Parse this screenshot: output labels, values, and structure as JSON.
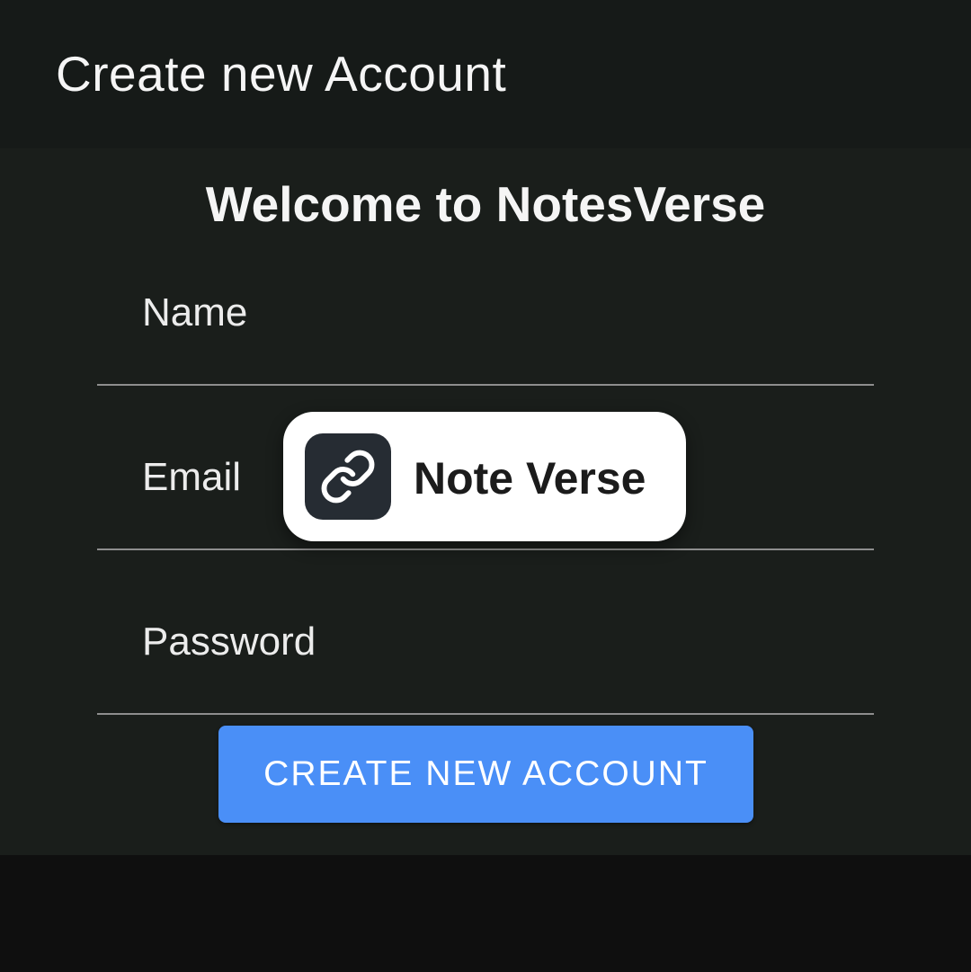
{
  "appbar": {
    "title": "Create new Account"
  },
  "form": {
    "welcome_text": "Welcome to NotesVerse",
    "fields": [
      {
        "label": "Name",
        "value": ""
      },
      {
        "label": "Email",
        "value": ""
      },
      {
        "label": "Password",
        "value": ""
      }
    ],
    "submit_label": "CREATE NEW ACCOUNT"
  },
  "toast": {
    "icon": "link-icon",
    "text": "Note Verse"
  },
  "colors": {
    "appbar_bg": "#161a18",
    "content_bg": "#1a1e1b",
    "button_bg": "#4a8ff7",
    "toast_bg": "#ffffff",
    "toast_icon_bg": "#262c33"
  }
}
